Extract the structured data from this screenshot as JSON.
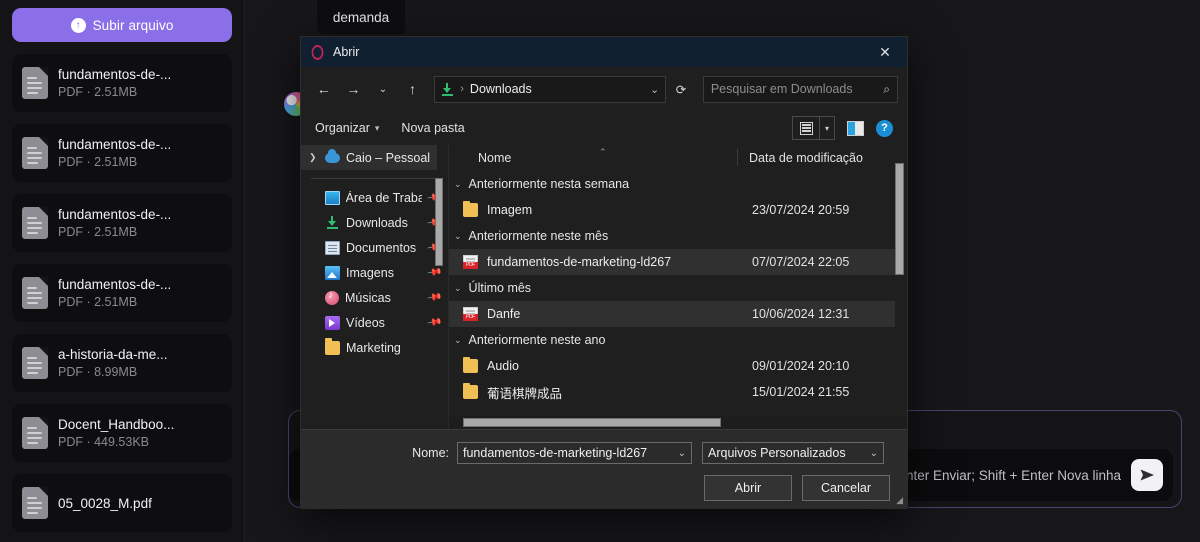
{
  "sidebar": {
    "upload_button": "Subir arquivo",
    "upload_icon": "upload-circle-icon",
    "files": [
      {
        "name": "fundamentos-de-...",
        "meta": "PDF · 2.51MB"
      },
      {
        "name": "fundamentos-de-...",
        "meta": "PDF · 2.51MB"
      },
      {
        "name": "fundamentos-de-...",
        "meta": "PDF · 2.51MB"
      },
      {
        "name": "fundamentos-de-...",
        "meta": "PDF · 2.51MB"
      },
      {
        "name": "a-historia-da-me...",
        "meta": "PDF · 8.99MB"
      },
      {
        "name": "Docent_Handboo...",
        "meta": "PDF · 449.53KB"
      },
      {
        "name": "05_0028_M.pdf",
        "meta": ""
      }
    ]
  },
  "chat": {
    "tab_label": "demanda",
    "composer_hint": "Enter Enviar; Shift + Enter Nova linha",
    "send_icon": "send-paper-plane-icon",
    "accent_border": "#4b4272"
  },
  "dialog": {
    "title": "Abrir",
    "app_icon": "opera-logo-icon",
    "close_icon": "close-icon",
    "nav": {
      "back_icon": "arrow-left-icon",
      "forward_icon": "arrow-right-icon",
      "recent_icon": "chevron-down-icon",
      "up_icon": "arrow-up-icon",
      "location_icon": "downloads-icon",
      "breadcrumb_separator": "›",
      "breadcrumb": "Downloads",
      "address_caret": "chevron-down-icon",
      "refresh_icon": "refresh-icon",
      "search_placeholder": "Pesquisar em Downloads",
      "search_icon": "search-icon"
    },
    "commands": {
      "organize": "Organizar",
      "organize_caret": "caret-down-icon",
      "new_folder": "Nova pasta",
      "view_icon": "view-list-icon",
      "view_caret": "caret-down-icon",
      "preview_pane_icon": "preview-pane-icon",
      "help_icon": "help-icon",
      "help_glyph": "?"
    },
    "tree": {
      "cloud_item": {
        "label": "Caio – Pessoal",
        "icon": "onedrive-cloud-icon",
        "selected": true
      },
      "items": [
        {
          "label": "Área de Traba",
          "icon": "desktop-icon",
          "pinned": true
        },
        {
          "label": "Downloads",
          "icon": "downloads-icon",
          "pinned": true
        },
        {
          "label": "Documentos",
          "icon": "documents-icon",
          "pinned": true
        },
        {
          "label": "Imagens",
          "icon": "pictures-icon",
          "pinned": true
        },
        {
          "label": "Músicas",
          "icon": "music-icon",
          "pinned": true
        },
        {
          "label": "Vídeos",
          "icon": "videos-icon",
          "pinned": true
        },
        {
          "label": "Marketing",
          "icon": "folder-icon",
          "pinned": false
        }
      ]
    },
    "list": {
      "columns": {
        "name": "Nome",
        "date": "Data de modificação"
      },
      "sort_indicator": "caret-up-icon",
      "groups": [
        {
          "label": "Anteriormente nesta semana",
          "rows": [
            {
              "name": "Imagem",
              "date": "23/07/2024 20:59",
              "icon": "folder-icon",
              "selected": false
            }
          ]
        },
        {
          "label": "Anteriormente neste mês",
          "rows": [
            {
              "name": "fundamentos-de-marketing-ld267",
              "date": "07/07/2024 22:05",
              "icon": "pdf-icon",
              "selected": true
            }
          ]
        },
        {
          "label": "Último mês",
          "rows": [
            {
              "name": "Danfe",
              "date": "10/06/2024 12:31",
              "icon": "pdf-icon",
              "selected": true
            }
          ]
        },
        {
          "label": "Anteriormente neste ano",
          "rows": [
            {
              "name": "Audio",
              "date": "09/01/2024 20:10",
              "icon": "folder-icon",
              "selected": false
            },
            {
              "name": "葡语棋牌成品",
              "date": "15/01/2024 21:55",
              "icon": "folder-icon",
              "selected": false
            }
          ]
        }
      ]
    },
    "footer": {
      "name_label": "Nome:",
      "name_value": "fundamentos-de-marketing-ld267",
      "name_caret": "chevron-down-icon",
      "filter_value": "Arquivos Personalizados",
      "filter_caret": "chevron-down-icon",
      "open_button": "Abrir",
      "cancel_button": "Cancelar",
      "resize_grip": "resize-grip-icon"
    }
  }
}
